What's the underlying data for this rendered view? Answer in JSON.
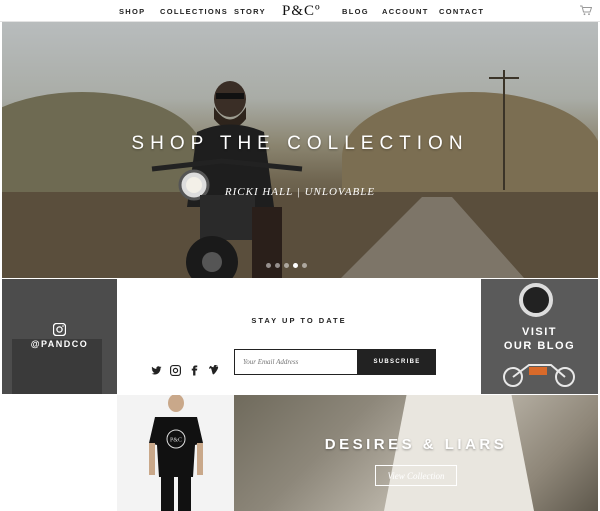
{
  "nav": {
    "items": [
      "SHOP",
      "COLLECTIONS",
      "STORY",
      "BLOG",
      "ACCOUNT",
      "CONTACT"
    ],
    "logo": "P&Cº",
    "cart_icon": "cart-icon"
  },
  "hero": {
    "title": "SHOP THE COLLECTION",
    "credit": "RICKI HALL | UNLOVABLE",
    "slides": 5,
    "active_slide": 4
  },
  "instagram": {
    "icon": "instagram-icon",
    "handle": "@PANDCO"
  },
  "newsletter": {
    "heading": "STAY UP TO DATE",
    "social_icons": [
      "twitter-icon",
      "instagram-icon",
      "facebook-icon",
      "vimeo-icon"
    ],
    "email_placeholder": "Your Email Address",
    "subscribe_label": "SUBSCRIBE"
  },
  "blog": {
    "line1": "VISIT",
    "line2": "OUR BLOG"
  },
  "promo": {
    "title": "DESIRES & LIARS",
    "cta_label": "View Collection"
  },
  "colors": {
    "dark": "#222222",
    "white": "#ffffff"
  }
}
